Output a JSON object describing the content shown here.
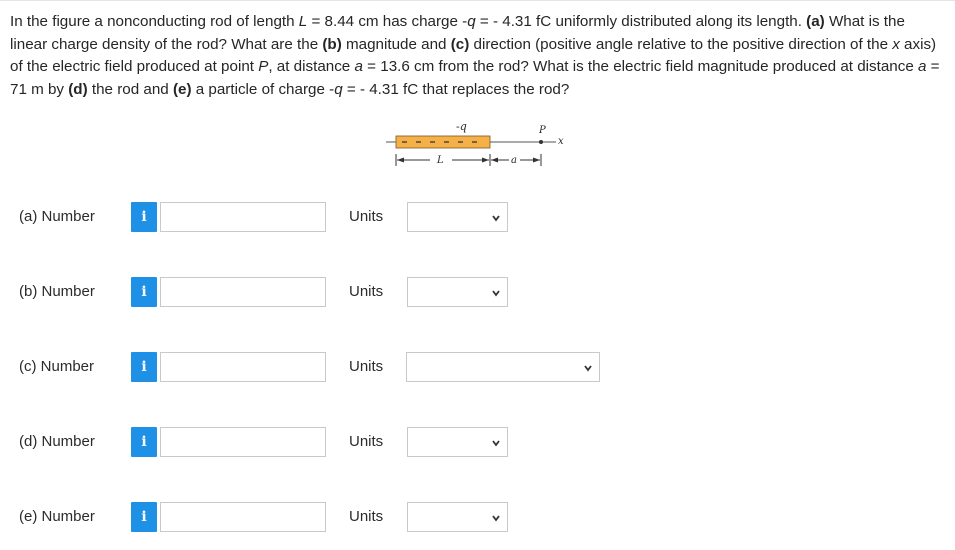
{
  "problem": {
    "s1": "In the figure a nonconducting rod of length ",
    "L_var": "L",
    "s2": " = 8.44 cm has charge -",
    "q_var1": "q",
    "s3": " = - 4.31 fC uniformly distributed along its length. ",
    "a_label": "(a)",
    "s4": " What is the linear charge density of the rod? What are the ",
    "b_label": "(b)",
    "s5": " magnitude and ",
    "c_label": "(c)",
    "s6": " direction (positive angle relative to the positive direction of the ",
    "x_var": "x",
    "s7": " axis) of the electric field produced at point ",
    "P_var": "P",
    "s8": ", at distance ",
    "a_var1": "a",
    "s9": " = 13.6 cm from the rod? What is the electric field magnitude produced at distance ",
    "a_var2": "a",
    "s10": " = 71 m by ",
    "d_label": "(d)",
    "s11": " the rod and ",
    "e_label": "(e)",
    "s12": " a particle of charge -",
    "q_var2": "q",
    "s13": " = - 4.31 fC that replaces the rod?"
  },
  "figure": {
    "charge_label": "-q",
    "point_label": "P",
    "axis_label": "x",
    "length_label": "L",
    "distance_label": "a",
    "rod_color": "#f5b04a"
  },
  "info_icon": "i",
  "answers": [
    {
      "part": "(a) Number",
      "units_label": "Units",
      "value": "",
      "unit": ""
    },
    {
      "part": "(b) Number",
      "units_label": "Units",
      "value": "",
      "unit": ""
    },
    {
      "part": "(c) Number",
      "units_label": "Units",
      "value": "",
      "unit": ""
    },
    {
      "part": "(d) Number",
      "units_label": "Units",
      "value": "",
      "unit": ""
    },
    {
      "part": "(e) Number",
      "units_label": "Units",
      "value": "",
      "unit": ""
    }
  ]
}
